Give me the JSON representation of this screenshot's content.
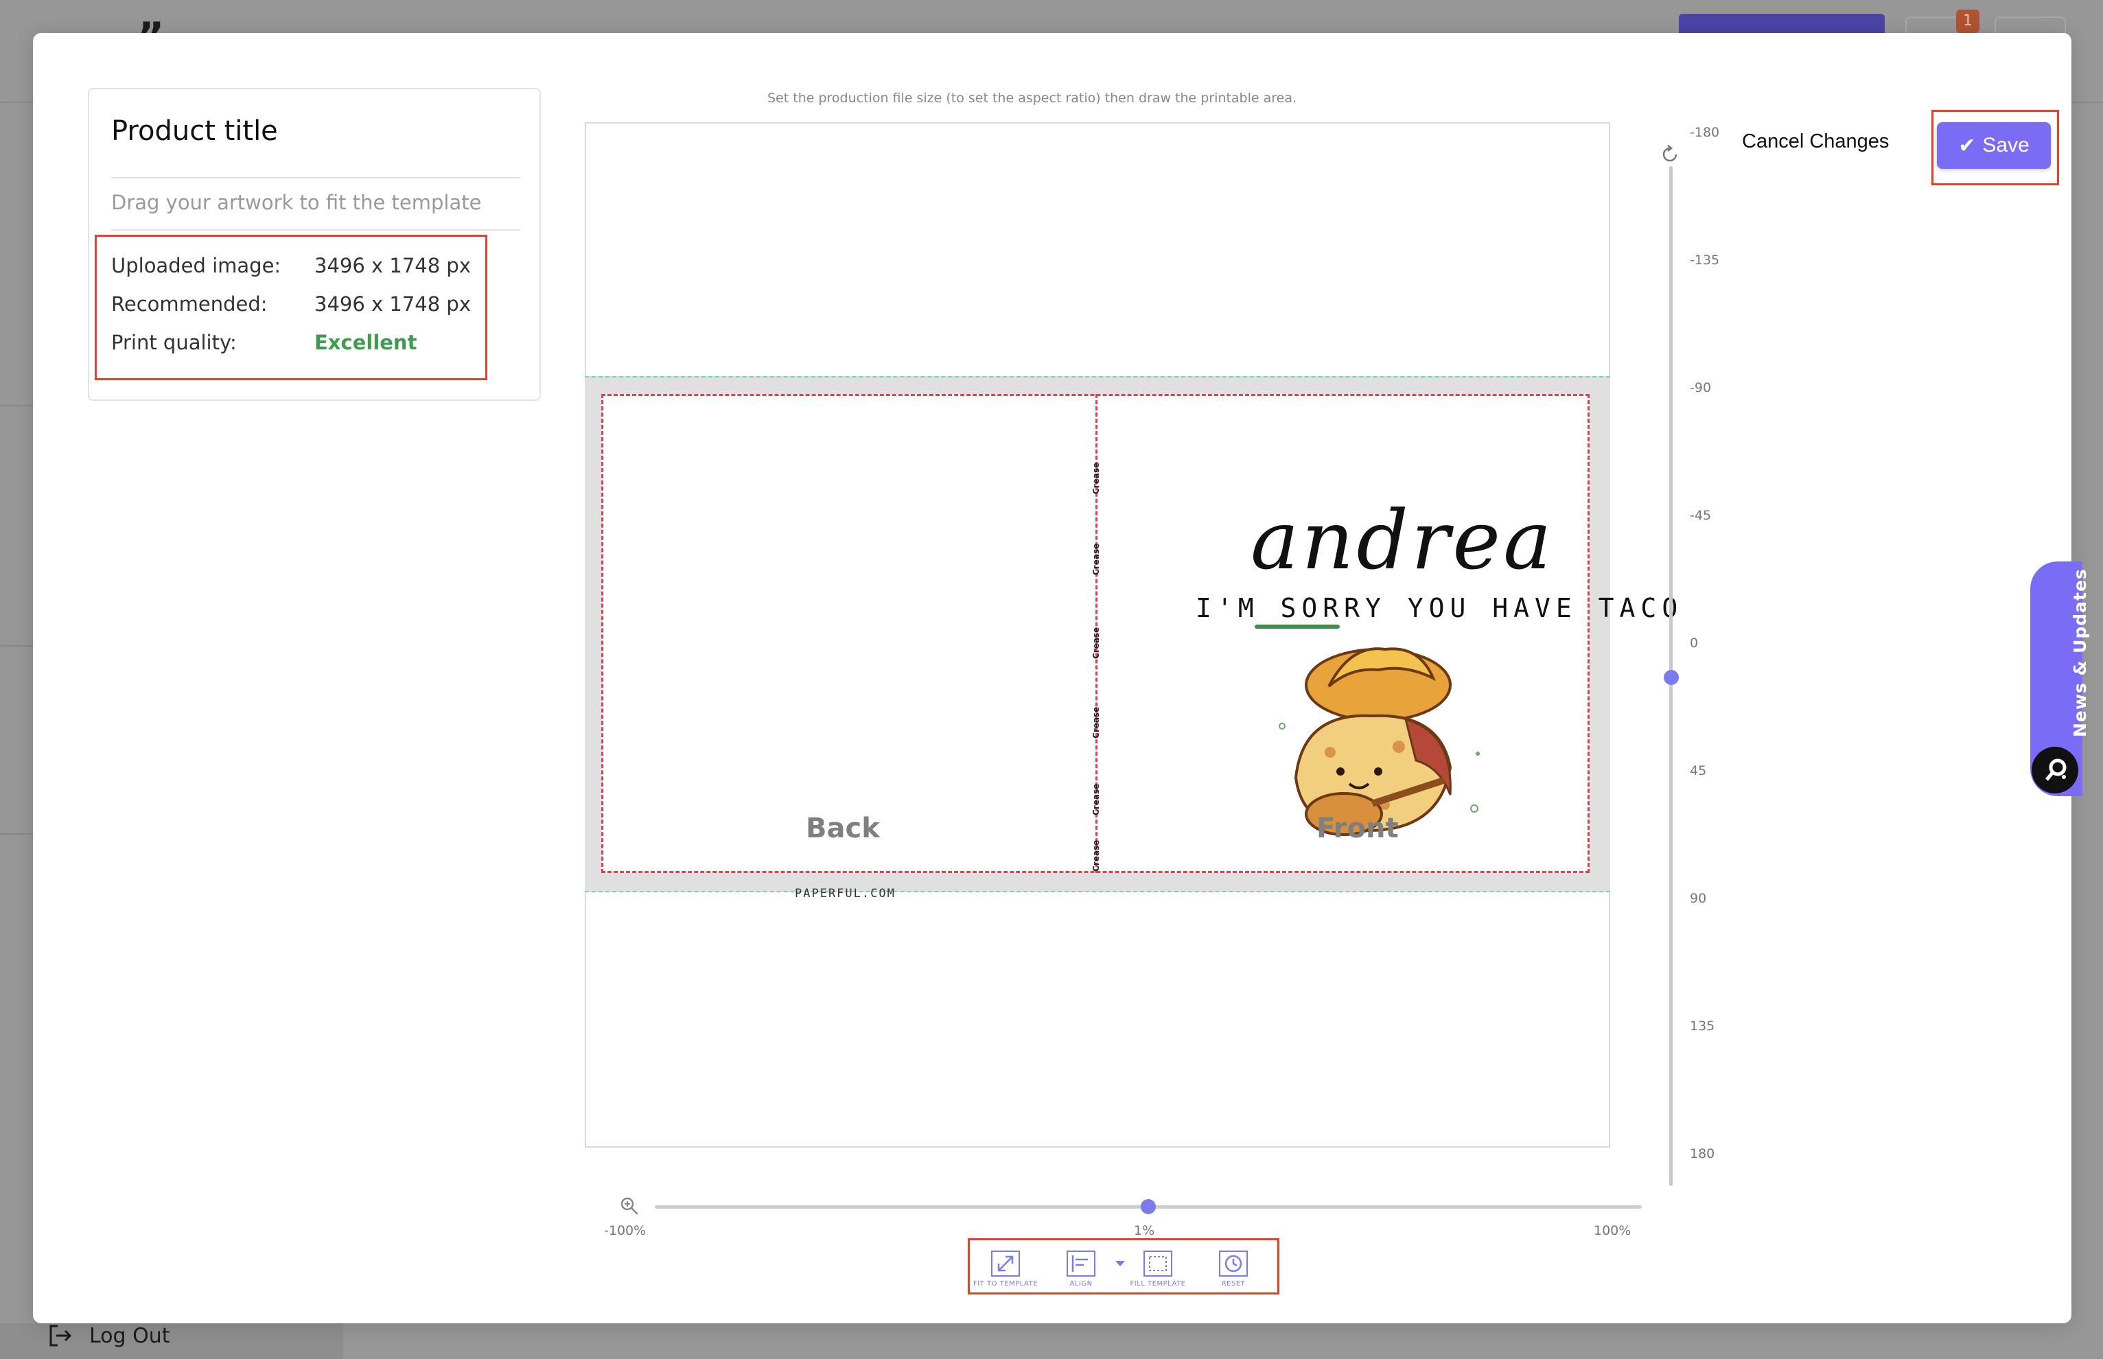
{
  "background": {
    "logout_label": "Log Out",
    "badge_count": "1"
  },
  "info": {
    "title": "Product title",
    "subtitle": "Drag your artwork to fit the template",
    "rows": [
      {
        "label": "Uploaded image:",
        "value": "3496 x 1748 px"
      },
      {
        "label": "Recommended:",
        "value": "3496 x 1748 px"
      },
      {
        "label": "Print quality:",
        "value": "Excellent"
      }
    ]
  },
  "canvas": {
    "hint": "Set the production file size (to set the aspect ratio) then draw the printable area.",
    "back_label": "Back",
    "front_label": "Front",
    "crease_label": "Crease",
    "artwork": {
      "name": "andrea",
      "message": "I'M SORRY YOU HAVE TACO",
      "credit": "PAPERFUL.COM"
    }
  },
  "rotation": {
    "ticks": [
      "-180",
      "-135",
      "-90",
      "-45",
      "0",
      "45",
      "90",
      "135",
      "180"
    ],
    "value": 0
  },
  "zoom": {
    "min_label": "-100%",
    "current_label": "1%",
    "max_label": "100%",
    "value": 1
  },
  "toolbar": {
    "fit": "FIT TO TEMPLATE",
    "align": "ALIGN",
    "fill": "FILL TEMPLATE",
    "reset": "RESET"
  },
  "actions": {
    "cancel": "Cancel Changes",
    "save": "Save"
  },
  "news_tab": {
    "label": "News & Updates"
  },
  "colors": {
    "accent": "#7b6cf6",
    "good": "#3e9c4c",
    "highlight": "#e3432b"
  }
}
